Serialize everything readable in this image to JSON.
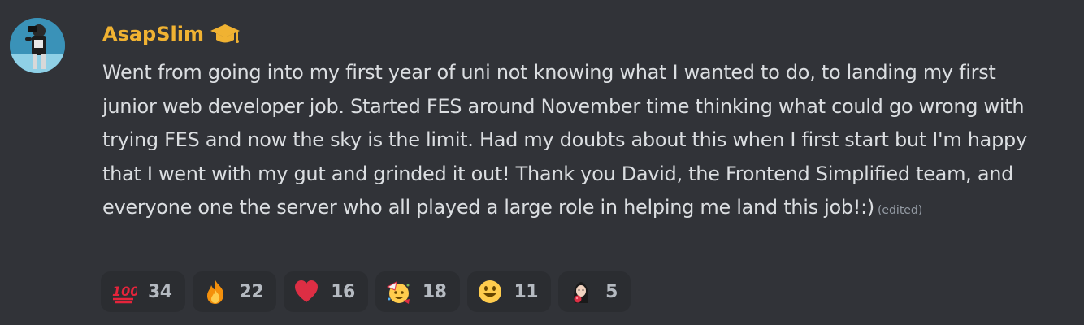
{
  "message": {
    "author": {
      "username": "AsapSlim",
      "role_icon": "graduation-cap-icon",
      "name_color": "#f0b232"
    },
    "text": "Went from going into my first year of uni not knowing what I wanted to do, to landing my first junior web developer job. Started FES around November time thinking what could go wrong with trying FES and now the sky is the limit. Had my doubts about this when I first start but I'm happy that I went with my gut and grinded it out! Thank you David, the Frontend Simplified team, and everyone one the server who all played a large role in helping me land this job!:)",
    "edited_label": "(edited)",
    "reactions": [
      {
        "emoji": "hundred-points-icon",
        "count": "34"
      },
      {
        "emoji": "fire-icon",
        "count": "22"
      },
      {
        "emoji": "red-heart-icon",
        "count": "16"
      },
      {
        "emoji": "party-face-icon",
        "count": "18"
      },
      {
        "emoji": "smiley-face-icon",
        "count": "11"
      },
      {
        "emoji": "custom-emoji-icon",
        "count": "5"
      }
    ]
  },
  "colors": {
    "background": "#313338",
    "text": "#dbdee1",
    "muted": "#949ba4",
    "reaction_bg": "#2b2d31"
  }
}
